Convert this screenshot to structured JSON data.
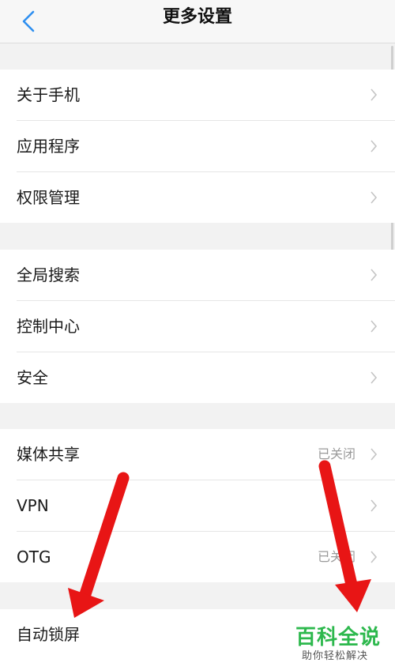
{
  "header": {
    "title": "更多设置",
    "back_icon": "chevron-left-icon"
  },
  "groups": [
    {
      "items": [
        {
          "label": "关于手机",
          "value": ""
        },
        {
          "label": "应用程序",
          "value": ""
        },
        {
          "label": "权限管理",
          "value": ""
        }
      ]
    },
    {
      "items": [
        {
          "label": "全局搜索",
          "value": ""
        },
        {
          "label": "控制中心",
          "value": ""
        },
        {
          "label": "安全",
          "value": ""
        }
      ]
    },
    {
      "items": [
        {
          "label": "媒体共享",
          "value": "已关闭"
        },
        {
          "label": "VPN",
          "value": ""
        },
        {
          "label": "OTG",
          "value": "已关闭"
        }
      ]
    },
    {
      "items": [
        {
          "label": "自动锁屏",
          "value": ""
        }
      ]
    }
  ],
  "watermark": {
    "title": "百科全说",
    "subtitle": "助你轻松解决"
  },
  "colors": {
    "accent": "#2e8ff0",
    "arrow": "#e81515",
    "watermark_green": "#2db84d"
  }
}
